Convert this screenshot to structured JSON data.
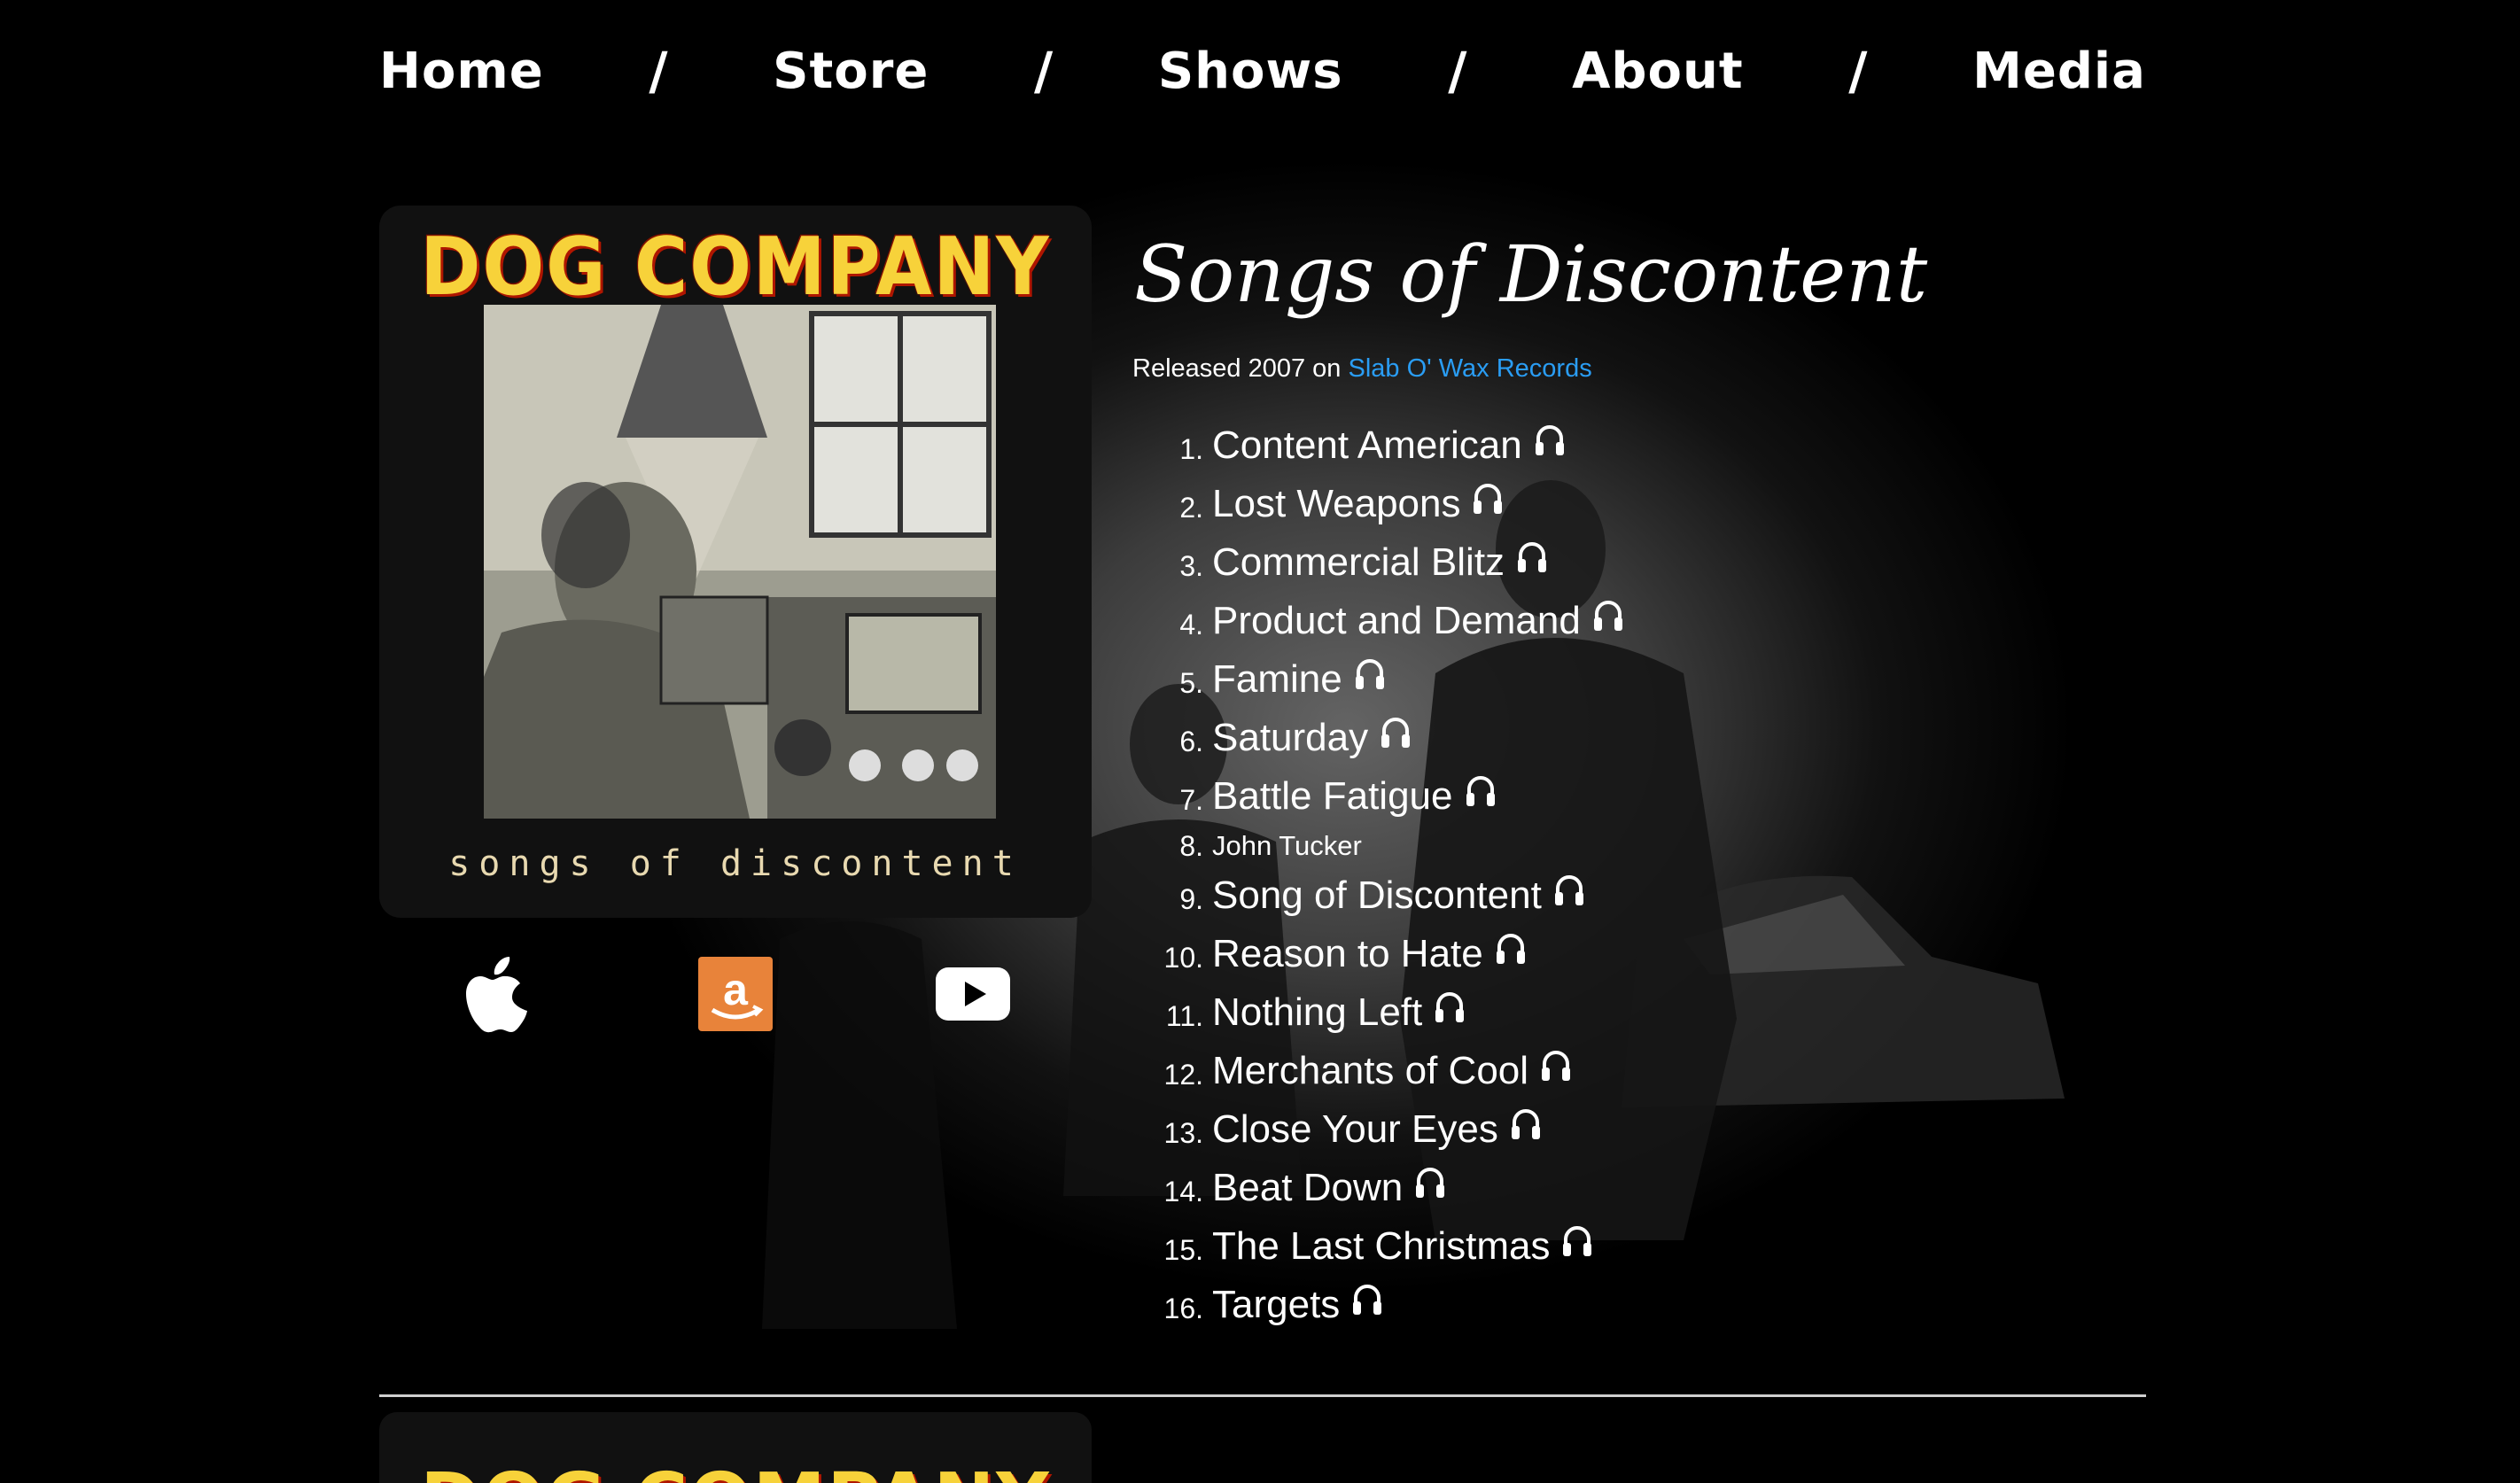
{
  "nav": {
    "items": [
      {
        "label": "Home"
      },
      {
        "label": "Store"
      },
      {
        "label": "Shows"
      },
      {
        "label": "About"
      },
      {
        "label": "Media"
      }
    ],
    "separator": "/"
  },
  "album": {
    "cover": {
      "band_name": "DOG COMPANY",
      "subtitle": "songs of discontent"
    },
    "title": "Songs of Discontent",
    "release_prefix": "Released 2007 on",
    "label": "Slab O' Wax Records",
    "stores": [
      {
        "icon": "apple-icon"
      },
      {
        "icon": "amazon-icon"
      },
      {
        "icon": "youtube-icon"
      }
    ],
    "tracks": [
      {
        "num": "1.",
        "title": "Content American",
        "listen": true
      },
      {
        "num": "2.",
        "title": "Lost Weapons",
        "listen": true
      },
      {
        "num": "3.",
        "title": "Commercial Blitz",
        "listen": true
      },
      {
        "num": "4.",
        "title": "Product and Demand",
        "listen": true
      },
      {
        "num": "5.",
        "title": "Famine",
        "listen": true
      },
      {
        "num": "6.",
        "title": "Saturday",
        "listen": true
      },
      {
        "num": "7.",
        "title": "Battle Fatigue",
        "listen": true
      },
      {
        "num": "8.",
        "title": "John Tucker",
        "listen": false
      },
      {
        "num": "9.",
        "title": "Song of Discontent",
        "listen": true
      },
      {
        "num": "10.",
        "title": "Reason to Hate",
        "listen": true
      },
      {
        "num": "11.",
        "title": "Nothing Left",
        "listen": true
      },
      {
        "num": "12.",
        "title": "Merchants of Cool",
        "listen": true
      },
      {
        "num": "13.",
        "title": "Close Your Eyes",
        "listen": true
      },
      {
        "num": "14.",
        "title": "Beat Down",
        "listen": true
      },
      {
        "num": "15.",
        "title": "The Last Christmas",
        "listen": true
      },
      {
        "num": "16.",
        "title": "Targets",
        "listen": true
      }
    ]
  },
  "next_album": {
    "band_name": "DOG COMPANY"
  },
  "colors": {
    "background": "#000000",
    "text": "#ffffff",
    "link": "#2a9df4",
    "amazon": "#e8833a",
    "cover_title": "#f7d23a"
  }
}
